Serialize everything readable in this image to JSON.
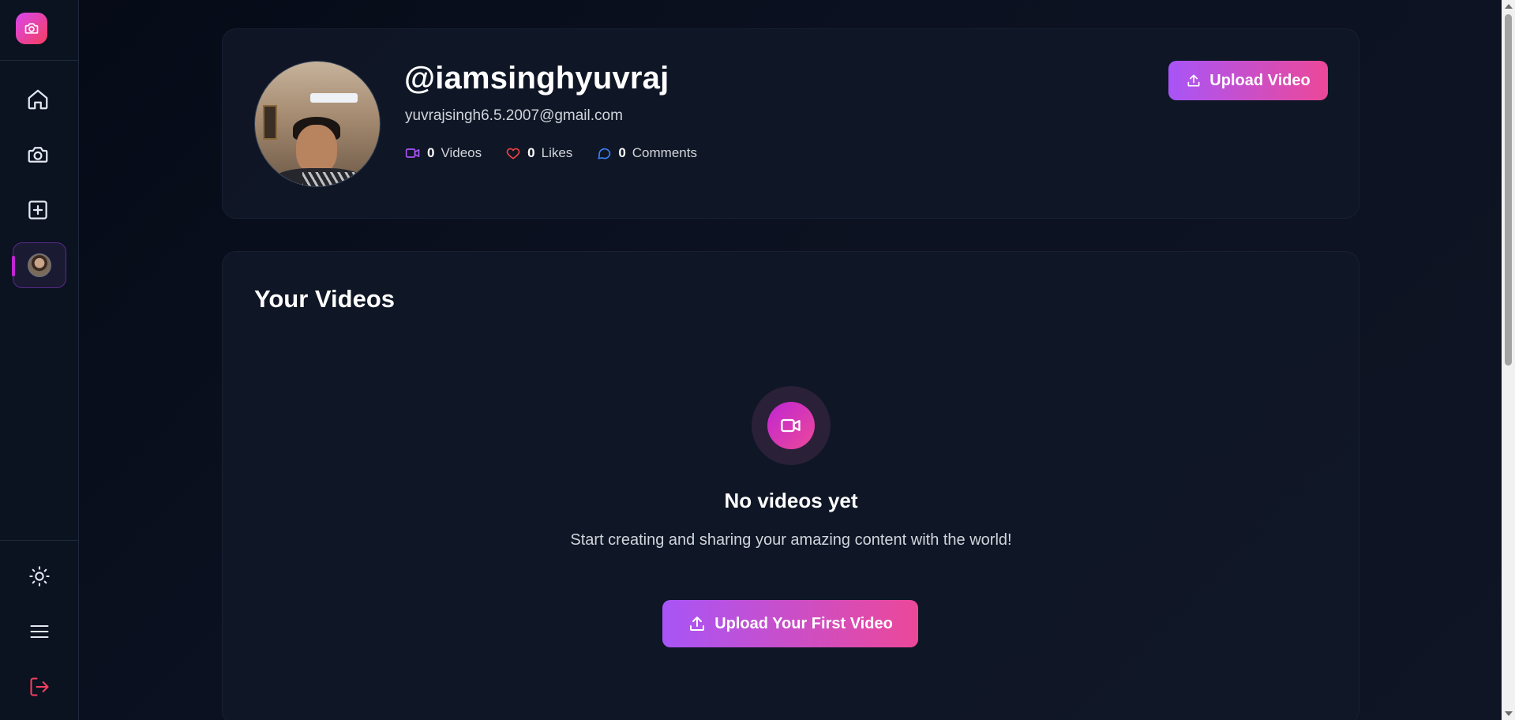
{
  "sidebar": {
    "logo_icon": "camera-icon",
    "nav": [
      {
        "name": "home",
        "icon": "home-icon"
      },
      {
        "name": "camera",
        "icon": "camera-icon"
      },
      {
        "name": "create",
        "icon": "plus-square-icon"
      },
      {
        "name": "profile",
        "icon": "avatar",
        "active": true
      }
    ],
    "bottom": [
      {
        "name": "theme",
        "icon": "sun-icon"
      },
      {
        "name": "menu",
        "icon": "menu-icon"
      },
      {
        "name": "logout",
        "icon": "logout-icon"
      }
    ]
  },
  "profile": {
    "username": "@iamsinghyuvraj",
    "email": "yuvrajsingh6.5.2007@gmail.com",
    "stats": [
      {
        "count": "0",
        "label": "Videos",
        "icon": "video-icon",
        "color": "#a855f7"
      },
      {
        "count": "0",
        "label": "Likes",
        "icon": "heart-icon",
        "color": "#ef4444"
      },
      {
        "count": "0",
        "label": "Comments",
        "icon": "comment-icon",
        "color": "#3b82f6"
      }
    ],
    "upload_label": "Upload Video"
  },
  "videos": {
    "title": "Your Videos",
    "empty_title": "No videos yet",
    "empty_desc": "Start creating and sharing your amazing content with the world!",
    "upload_first_label": "Upload Your First Video"
  },
  "colors": {
    "accent_from": "#a855f7",
    "accent_to": "#ec4899",
    "logout": "#f43f5e"
  }
}
